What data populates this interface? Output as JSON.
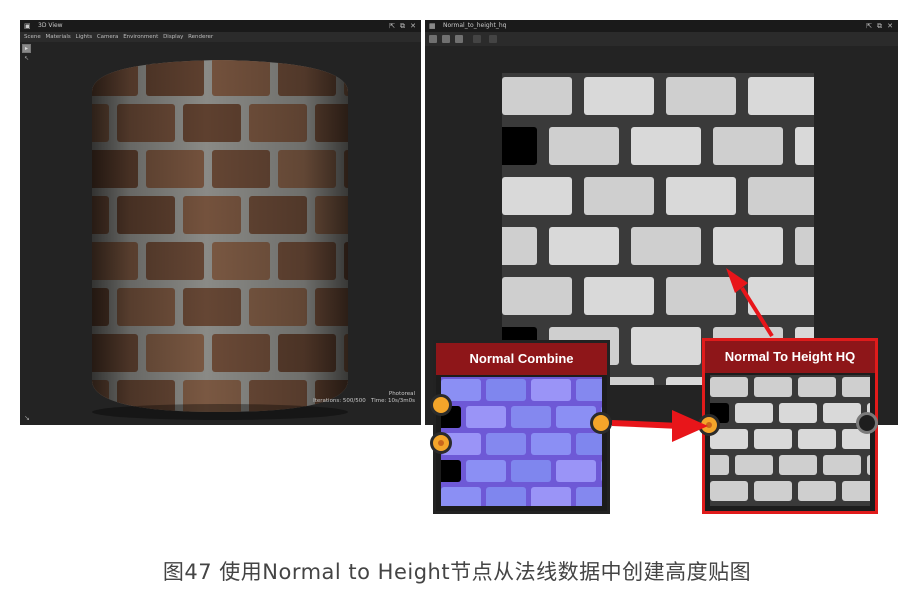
{
  "view3d": {
    "title": "3D View",
    "menu": [
      "Scene",
      "Materials",
      "Lights",
      "Camera",
      "Environment",
      "Display",
      "Renderer"
    ],
    "status_mode": "Photoreal",
    "status_iterations": "Iterations: 500/500",
    "status_time": "Time: 10s/3m0s"
  },
  "view2d": {
    "title": "Normal_to_height_hq"
  },
  "nodes": {
    "combine": {
      "title": "Normal Combine"
    },
    "height": {
      "title": "Normal To Height HQ"
    }
  },
  "caption": "图47 使用Normal to Height节点从法线数据中创建高度贴图",
  "colors": {
    "node_header": "#8e1619",
    "highlight": "#e01b1b",
    "socket": "#f4a52a",
    "panel_bg": "#232323"
  },
  "icons": [
    "window-icon",
    "pin-icon",
    "float-icon",
    "close-icon",
    "select-tool-icon",
    "grid-icon",
    "arrow-icon"
  ]
}
